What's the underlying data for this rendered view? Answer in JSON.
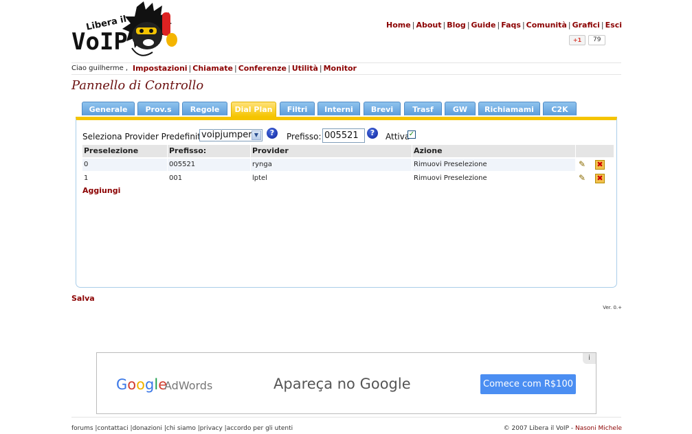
{
  "logo": {
    "line1": "Libera il",
    "line2": "VoIP"
  },
  "topnav": [
    "Home",
    "About",
    "Blog",
    "Guide",
    "Faqs",
    "Comunità",
    "Grafici",
    "Esci"
  ],
  "gplus": {
    "label": "+1",
    "count": "79"
  },
  "greeting": "Ciao guilherme ,",
  "subnav": [
    "Impostazioni",
    "Chiamate",
    "Conferenze",
    "Utilità",
    "Monitor"
  ],
  "page_title": "Pannello di Controllo",
  "tabs": [
    "Generale",
    "Prov.s",
    "Regole",
    "Dial Plan",
    "Filtri",
    "Interni",
    "Brevi",
    "Trasf",
    "GW",
    "Richiamami",
    "C2K"
  ],
  "active_tab": "Dial Plan",
  "provider_select": {
    "label": "Seleziona Provider Predefinito:",
    "value": "voipjumper"
  },
  "prefix": {
    "label": "Prefisso:",
    "value": "005521"
  },
  "active": {
    "label": "Attiva",
    "checked": true
  },
  "table": {
    "headers": [
      "Preselezione",
      "Prefisso:",
      "Provider",
      "Azione"
    ],
    "rows": [
      {
        "preselezione": "0",
        "prefisso": "005521",
        "provider": "rynga",
        "azione": "Rimuovi Preselezione"
      },
      {
        "preselezione": "1",
        "prefisso": "001",
        "provider": "lptel",
        "azione": "Rimuovi Preselezione"
      }
    ]
  },
  "add_link": "Aggiungi",
  "save_link": "Salva",
  "version": "Ver. 0.+",
  "ad": {
    "google": "Google",
    "adwords": "AdWords",
    "tagline": "Apareça no Google",
    "cta": "Comece com R$100",
    "info": "i"
  },
  "footer_links": [
    "forums",
    "contattaci",
    "donazioni",
    "chi siamo",
    "privacy",
    "accordo per gli utenti"
  ],
  "copyright": {
    "text": "© 2007 Libera il VoIP - ",
    "author": "Nasoni Michele"
  },
  "colors": {
    "link": "#8b0000",
    "tab": "#6aa8e3",
    "active_tab": "#f5c400",
    "panel_border": "#a9cde9"
  }
}
